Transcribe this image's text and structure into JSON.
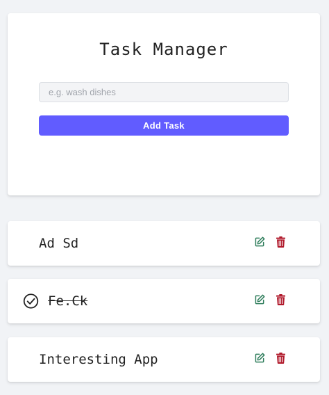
{
  "header": {
    "title": "Task Manager"
  },
  "form": {
    "input_value": "",
    "input_placeholder": "e.g. wash dishes",
    "add_button_label": "Add Task"
  },
  "tasks": [
    {
      "text": "Ad Sd",
      "completed": false,
      "edit_icon": "edit-icon",
      "delete_icon": "trash-icon"
    },
    {
      "text": "Fe.Ck",
      "completed": true,
      "edit_icon": "edit-icon",
      "delete_icon": "trash-icon"
    },
    {
      "text": "Interesting App",
      "completed": false,
      "edit_icon": "edit-icon",
      "delete_icon": "trash-icon"
    }
  ],
  "colors": {
    "background": "#f1f3f6",
    "accent": "#615cff",
    "edit": "#2e7d5b",
    "delete": "#b0182a",
    "text": "#222222"
  }
}
